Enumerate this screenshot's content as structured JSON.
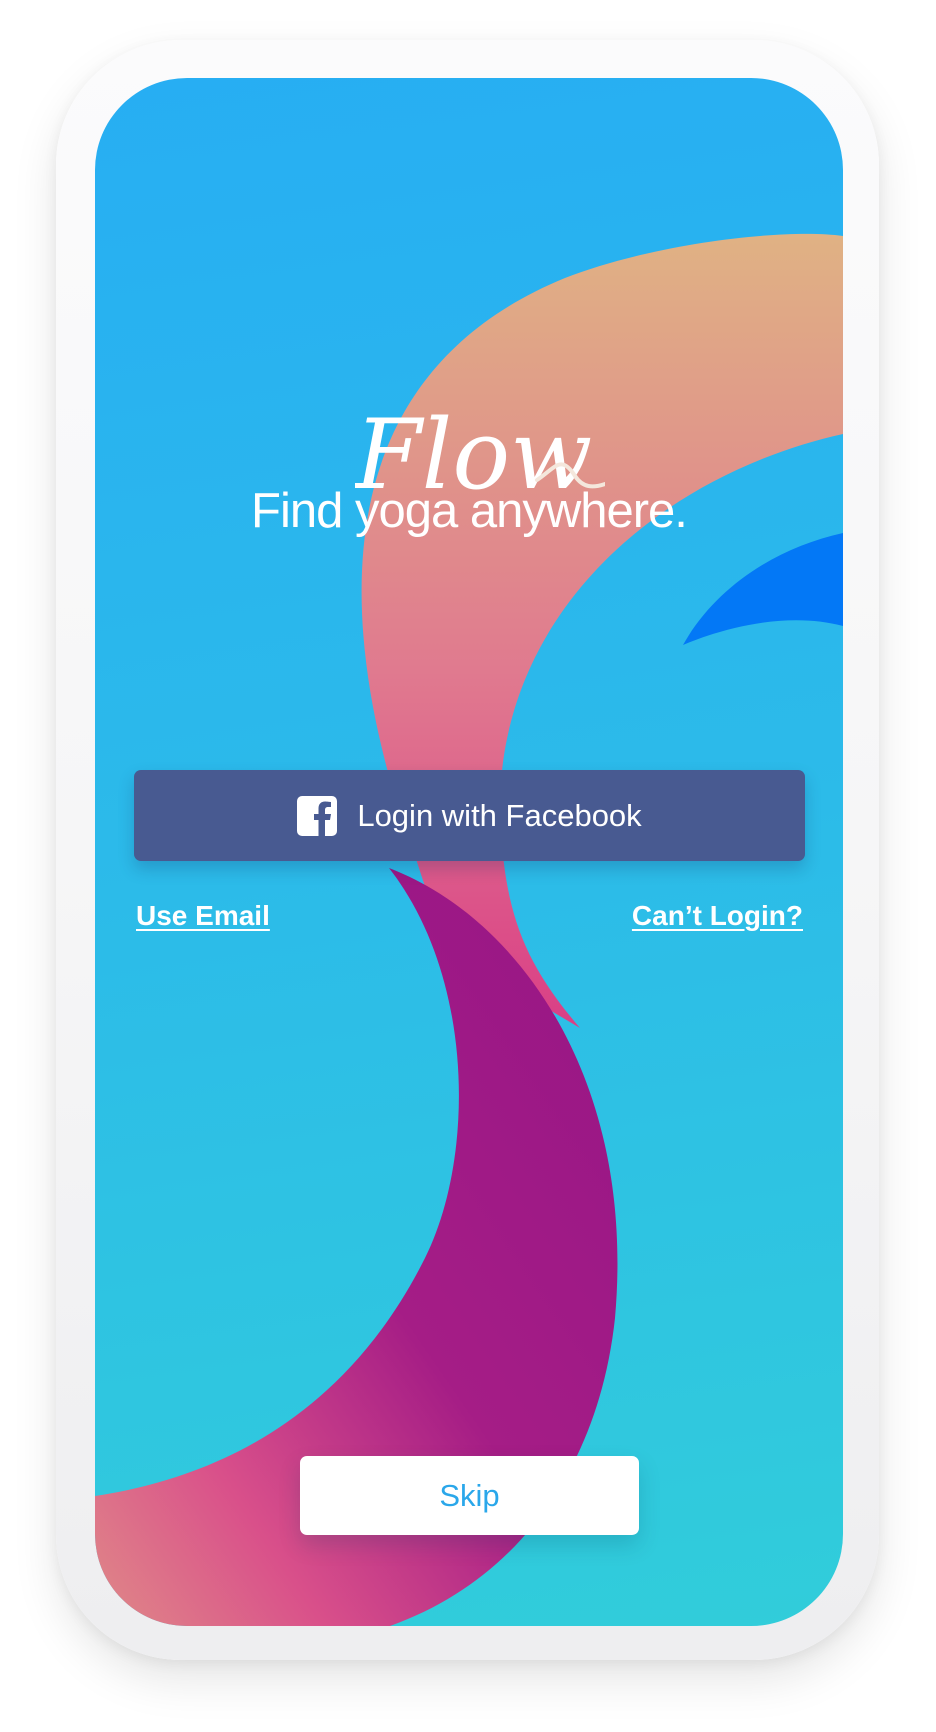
{
  "app": {
    "logo_text": "Flow",
    "tagline": "Find yoga anywhere."
  },
  "auth": {
    "facebook_button_label": "Login with Facebook",
    "facebook_icon": "facebook-icon",
    "use_email_label": "Use Email",
    "cant_login_label": "Can’t Login?",
    "skip_label": "Skip"
  },
  "colors": {
    "background_top": "#27aef3",
    "background_bottom": "#31cdda",
    "facebook_blue": "#485a91",
    "skip_text": "#2aa7ea",
    "accent_peach": "#e0b284",
    "accent_pink": "#de4f8b",
    "accent_purple": "#961585",
    "accent_blue": "#0378f6"
  }
}
